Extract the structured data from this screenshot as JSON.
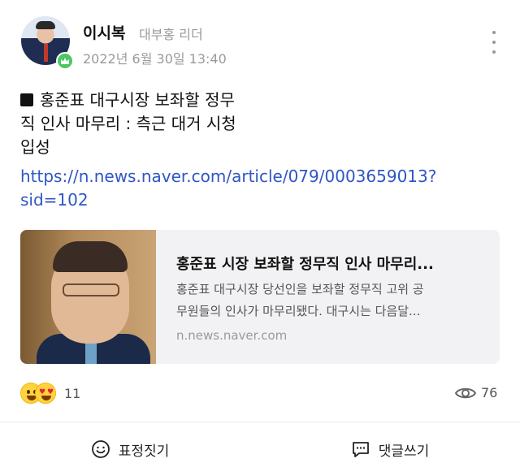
{
  "post": {
    "author": "이시복",
    "role": "대부홍 리더",
    "date": "2022년 6월 30일 13:40",
    "text_lines": [
      "홍준표 대구시장 보좌할 정무",
      "직 인사 마무리 : 측근 대거 시청",
      "입성"
    ],
    "link_lines": [
      "https://n.news.naver.com/article/079/0003659013?",
      "sid=102"
    ]
  },
  "card": {
    "title": "홍준표 시장 보좌할 정무직 인사 마무리...",
    "desc_lines": [
      "홍준표 대구시장 당선인을 보좌할 정무직 고위 공",
      "무원들의 인사가 마무리됐다. 대구시는 다음달..."
    ],
    "domain": "n.news.naver.com"
  },
  "stats": {
    "reaction_count": "11",
    "view_count": "76"
  },
  "actions": {
    "react_label": "표정짓기",
    "comment_label": "댓글쓰기"
  },
  "icons": {
    "more": "more-vertical-icon",
    "badge": "crown-icon",
    "views": "eye-icon",
    "react": "smile-icon",
    "comment": "comment-icon"
  },
  "colors": {
    "link": "#2f56c4",
    "badge": "#4cc764",
    "muted": "#9a9a9a",
    "card_bg": "#f2f2f4"
  }
}
